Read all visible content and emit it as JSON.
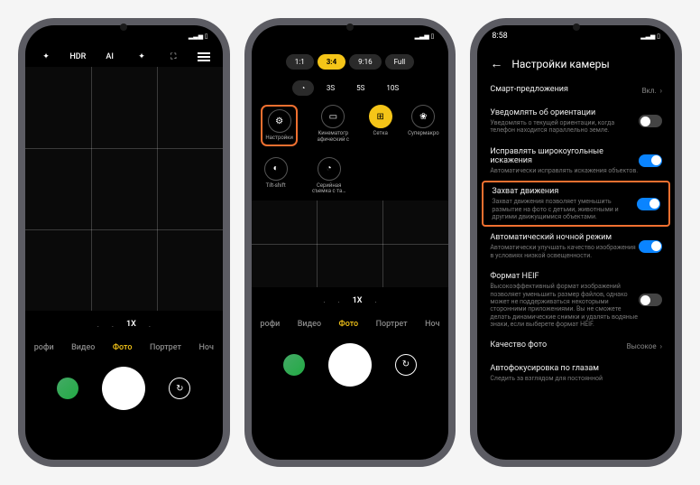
{
  "screen1": {
    "toolbar": {
      "flash": "✦",
      "hdr": "HDR",
      "ai": "AI",
      "filter": "✦",
      "scan": "⛶",
      "menu": "menu"
    },
    "zoom": {
      "wide": ".",
      "ultrawide": ".",
      "x1": "1X",
      "tele": "."
    },
    "modes": {
      "m1": "рофи",
      "m2": "Видео",
      "m3": "Фото",
      "m4": "Портрет",
      "m5": "Ноч"
    }
  },
  "screen2": {
    "aspects": {
      "a1": "1:1",
      "a2": "3:4",
      "a3": "9:16",
      "a4": "Full"
    },
    "timers": {
      "icon": "◔",
      "t1": "3S",
      "t2": "5S",
      "t3": "10S"
    },
    "options": {
      "settings": {
        "label": "Настройки"
      },
      "cinematic": {
        "label": "Кинематогр афический с"
      },
      "grid": {
        "label": "Сетка"
      },
      "supermacro": {
        "label": "Супермакро"
      },
      "tiltshift": {
        "label": "Tilt-shift"
      },
      "burst": {
        "label": "Серийная съемка с та…"
      }
    },
    "zoom": {
      "x1": "1X"
    },
    "modes": {
      "m1": "рофи",
      "m2": "Видео",
      "m3": "Фото",
      "m4": "Портрет",
      "m5": "Ноч"
    }
  },
  "screen3": {
    "status_time": "8:58",
    "header_title": "Настройки камеры",
    "smart": {
      "title": "Смарт-предложения",
      "value": "Вкл."
    },
    "orient": {
      "title": "Уведомлять об ориентации",
      "desc": "Уведомлять о текущей ориентации, когда телефон находится параллельно земле."
    },
    "distort": {
      "title": "Исправлять широкоугольные искажения",
      "desc": "Автоматически исправлять искажения объектов."
    },
    "motion": {
      "title": "Захват движения",
      "desc": "Захват движения позволяет уменьшить размытие на фото с детьми, животными и другими движущимися объектами."
    },
    "night": {
      "title": "Автоматический ночной режим",
      "desc": "Автоматически улучшать качество изображения в условиях низкой освещенности."
    },
    "heif": {
      "title": "Формат HEIF",
      "desc": "Высокоэффективный формат изображений позволяет уменьшить размер файлов, однако может не поддерживаться некоторыми сторонними приложениями. Вы не сможете делать динамические снимки и удалять водяные знаки, если выберете формат HEIF."
    },
    "quality": {
      "title": "Качество фото",
      "value": "Высокое"
    },
    "autofocus": {
      "title": "Автофокусировка по глазам",
      "desc": "Следить за взглядом для постоянной"
    }
  }
}
